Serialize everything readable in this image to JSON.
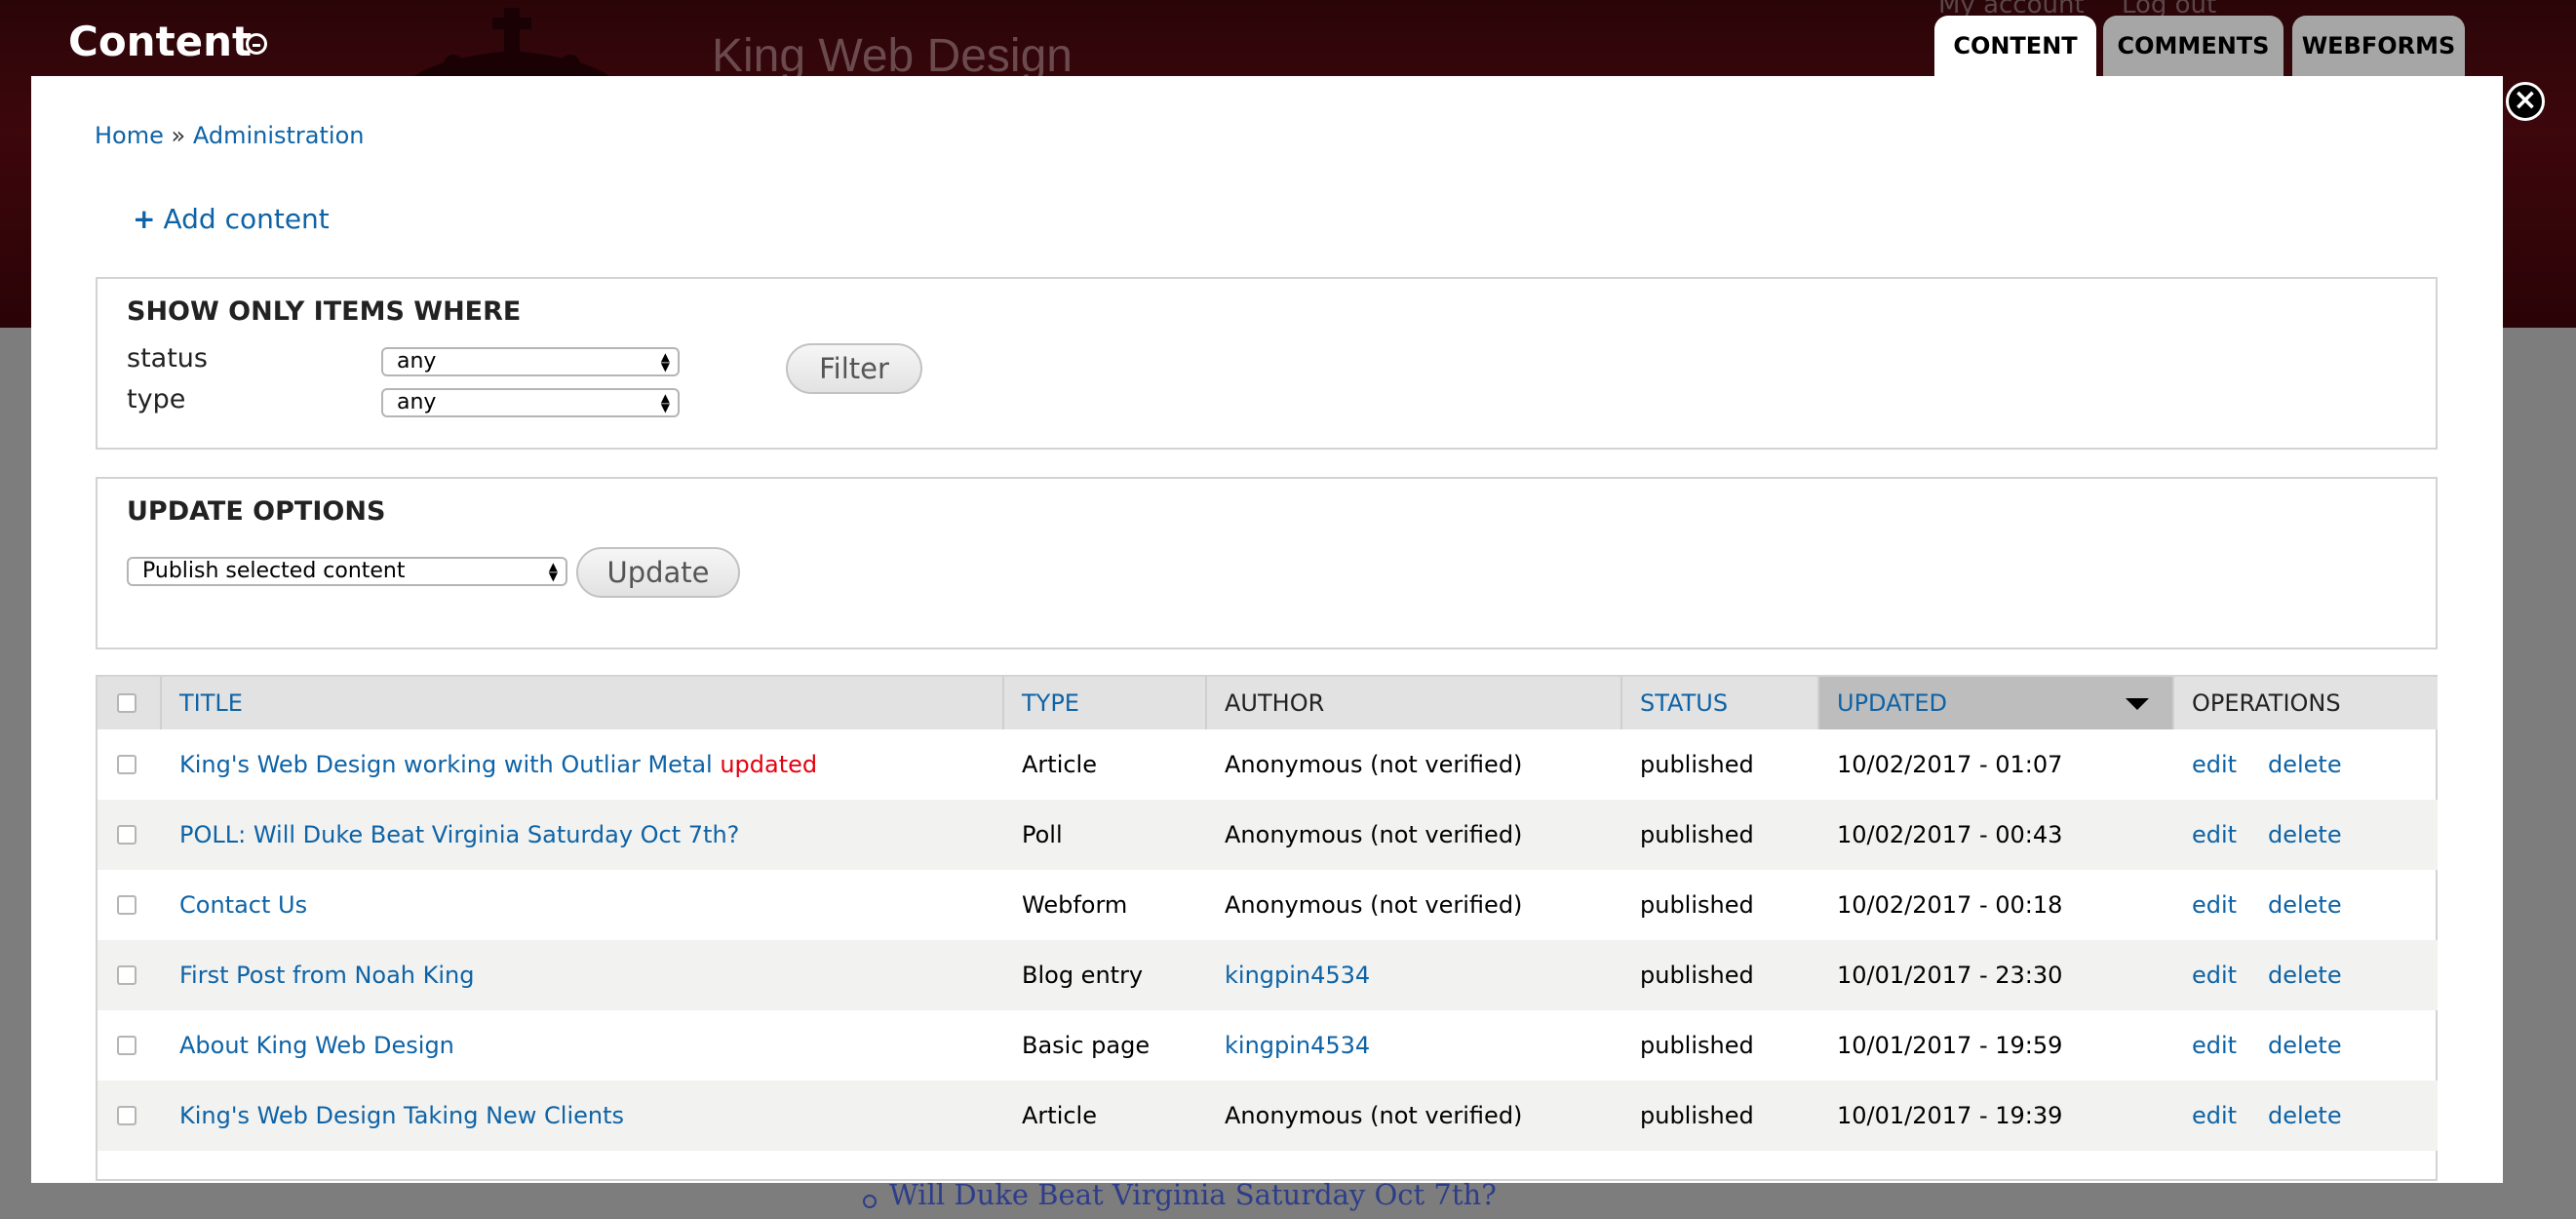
{
  "background": {
    "site_name": "King Web Design",
    "user_links": [
      "My account",
      "Log out"
    ],
    "poll_item": "Will Duke Beat Virginia Saturday Oct 7th?"
  },
  "overlay": {
    "title": "Content",
    "close_label": "×",
    "tabs": [
      {
        "label": "CONTENT",
        "active": true
      },
      {
        "label": "COMMENTS",
        "active": false
      },
      {
        "label": "WEBFORMS",
        "active": false
      }
    ]
  },
  "breadcrumb": {
    "home": "Home",
    "separator": "»",
    "administration": "Administration"
  },
  "add_content": {
    "icon": "+",
    "label": "Add content"
  },
  "filter": {
    "heading": "SHOW ONLY ITEMS WHERE",
    "status_label": "status",
    "status_value": "any",
    "type_label": "type",
    "type_value": "any",
    "button": "Filter"
  },
  "update_options": {
    "heading": "UPDATE OPTIONS",
    "operation_value": "Publish selected content",
    "button": "Update"
  },
  "table": {
    "headers": {
      "title": "TITLE",
      "type": "TYPE",
      "author": "AUTHOR",
      "status": "STATUS",
      "updated": "UPDATED",
      "operations": "OPERATIONS"
    },
    "sort_column": "updated",
    "sort_direction": "desc",
    "rows": [
      {
        "title": "King's Web Design working with Outliar Metal",
        "marker": "updated",
        "type": "Article",
        "author": "Anonymous (not verified)",
        "author_link": false,
        "status": "published",
        "updated": "10/02/2017 - 01:07",
        "edit": "edit",
        "delete": "delete"
      },
      {
        "title": "POLL: Will Duke Beat Virginia Saturday Oct 7th?",
        "marker": "",
        "type": "Poll",
        "author": "Anonymous (not verified)",
        "author_link": false,
        "status": "published",
        "updated": "10/02/2017 - 00:43",
        "edit": "edit",
        "delete": "delete"
      },
      {
        "title": "Contact Us",
        "marker": "",
        "type": "Webform",
        "author": "Anonymous (not verified)",
        "author_link": false,
        "status": "published",
        "updated": "10/02/2017 - 00:18",
        "edit": "edit",
        "delete": "delete"
      },
      {
        "title": "First Post from Noah King",
        "marker": "",
        "type": "Blog entry",
        "author": "kingpin4534",
        "author_link": true,
        "status": "published",
        "updated": "10/01/2017 - 23:30",
        "edit": "edit",
        "delete": "delete"
      },
      {
        "title": "About King Web Design",
        "marker": "",
        "type": "Basic page",
        "author": "kingpin4534",
        "author_link": true,
        "status": "published",
        "updated": "10/01/2017 - 19:59",
        "edit": "edit",
        "delete": "delete"
      },
      {
        "title": "King's Web Design Taking New Clients",
        "marker": "",
        "type": "Article",
        "author": "Anonymous (not verified)",
        "author_link": false,
        "status": "published",
        "updated": "10/01/2017 - 19:39",
        "edit": "edit",
        "delete": "delete"
      }
    ]
  },
  "colors": {
    "link": "#0e63a6",
    "updated_marker": "#e4000f",
    "header_bg": "#3d070c"
  }
}
